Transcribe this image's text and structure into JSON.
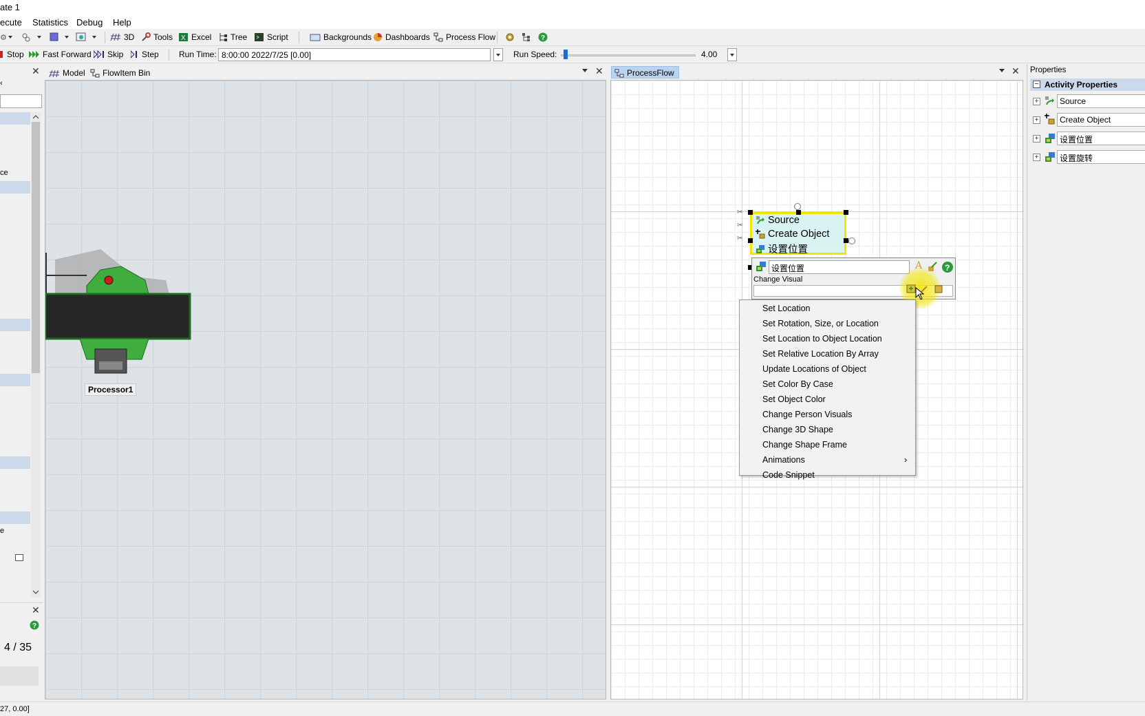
{
  "window": {
    "title": "ate 1"
  },
  "menu": [
    "ecute",
    "Statistics",
    "Debug",
    "Help"
  ],
  "toolbar1": {
    "view3d": "3D",
    "tools": "Tools",
    "excel": "Excel",
    "tree": "Tree",
    "script": "Script",
    "backgrounds": "Backgrounds",
    "dashboards": "Dashboards",
    "process_flow": "Process Flow"
  },
  "toolbar2": {
    "stop": "Stop",
    "fast_forward": "Fast Forward",
    "skip": "Skip",
    "step": "Step",
    "run_time_label": "Run Time:",
    "run_time_value": "8:00:00  2022/7/25  [0.00]",
    "run_speed_label": "Run Speed:",
    "run_speed_value": "4.00",
    "run_speed_fraction": 0.02
  },
  "left_panel": {
    "partial_text_1": "ce",
    "partial_text_2": "e",
    "bottom_counter": "4 / 35"
  },
  "model_pane": {
    "tabs": [
      {
        "label": "Model"
      },
      {
        "label": "FlowItem Bin"
      }
    ],
    "processor_label": "Processor1"
  },
  "processflow_pane": {
    "tab": "ProcessFlow",
    "activities": [
      "Source",
      "Create Object",
      "设置位置"
    ],
    "editor": {
      "name_value": "设置位置",
      "field_label": "Change Visual"
    },
    "dropdown": [
      "Set Location",
      "Set Rotation, Size, or Location",
      "Set Location to Object Location",
      "Set Relative Location By Array",
      "Update Locations of Object",
      "Set Color By Case",
      "Set Object Color",
      "Change Person Visuals",
      "Change 3D Shape",
      "Change Shape Frame",
      "Animations",
      "Code Snippet"
    ]
  },
  "properties": {
    "header": "Properties",
    "section": "Activity Properties",
    "rows": [
      "Source",
      "Create Object",
      "设置位置",
      "设置旋转"
    ]
  },
  "status_bar": {
    "text": "27, 0.00]"
  },
  "colors": {
    "highlight_yellow": "#f2e600",
    "pf_block": "#d9f2f2",
    "processor_green": "#3fae3f",
    "tab_blue": "#b9d4f0"
  }
}
